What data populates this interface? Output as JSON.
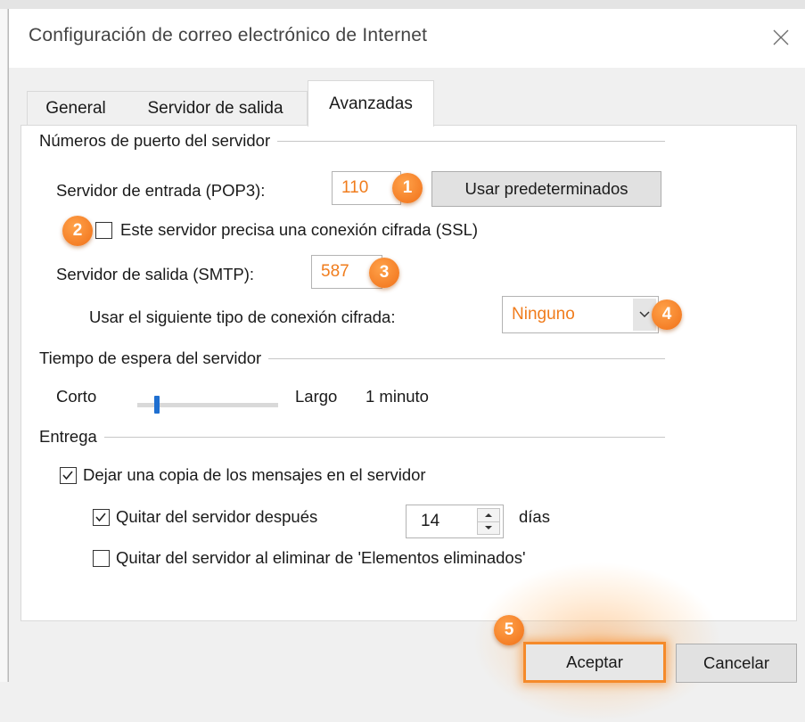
{
  "window": {
    "title": "Configuración de correo electrónico de Internet"
  },
  "tabs": [
    {
      "label": "General"
    },
    {
      "label": "Servidor de salida"
    },
    {
      "label": "Avanzadas",
      "selected": true
    }
  ],
  "ports": {
    "group_title": "Números de puerto del servidor",
    "incoming_label": "Servidor de entrada (POP3):",
    "incoming_value": "110",
    "defaults_button": "Usar predeterminados",
    "ssl_label": "Este servidor precisa una conexión cifrada (SSL)",
    "ssl_checked": false,
    "outgoing_label": "Servidor de salida (SMTP):",
    "outgoing_value": "587",
    "encryption_label": "Usar el siguiente tipo de conexión cifrada:",
    "encryption_value": "Ninguno"
  },
  "timeout": {
    "group_title": "Tiempo de espera del servidor",
    "short_label": "Corto",
    "long_label": "Largo",
    "value_label": "1 minuto",
    "slider_fraction": 0.1
  },
  "delivery": {
    "group_title": "Entrega",
    "leave_copy_label": "Dejar una copia de los mensajes en el servidor",
    "leave_copy_checked": true,
    "remove_after_label": "Quitar del servidor después",
    "remove_after_checked": true,
    "remove_after_days": "14",
    "days_label": "días",
    "remove_deleted_label": "Quitar del servidor al eliminar de 'Elementos eliminados'",
    "remove_deleted_checked": false
  },
  "badges": [
    "1",
    "2",
    "3",
    "4",
    "5"
  ],
  "buttons": {
    "ok": "Aceptar",
    "cancel": "Cancelar"
  },
  "colors": {
    "accent_orange": "#f07c1c",
    "slider_blue": "#1f6fd0"
  },
  "icons": {
    "close": "close-icon",
    "dropdown": "chevron-down-icon",
    "check": "checkmark-icon",
    "spin_up": "spin-up-icon",
    "spin_down": "spin-down-icon"
  }
}
